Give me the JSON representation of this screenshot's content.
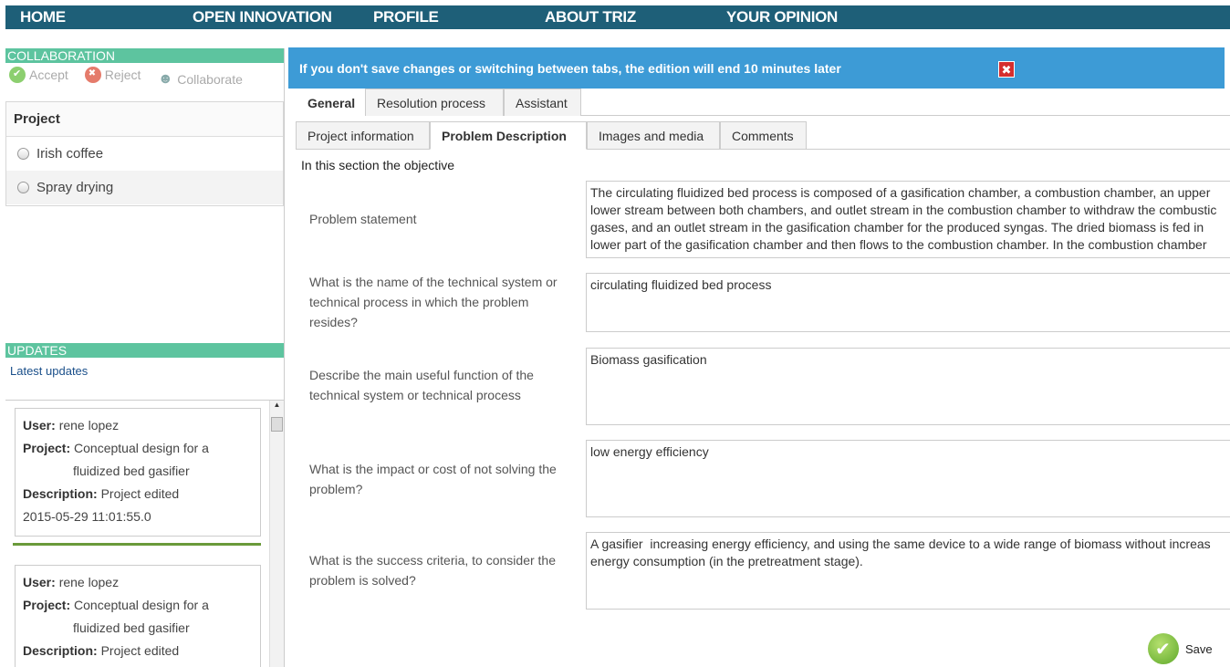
{
  "nav": [
    "HOME",
    "OPEN INNOVATION",
    "PROFILE",
    "ABOUT TRIZ",
    "YOUR OPINION"
  ],
  "collaboration": {
    "title": "COLLABORATION",
    "actions": [
      "Accept",
      "Reject",
      "Collaborate"
    ]
  },
  "project": {
    "title": "Project",
    "items": [
      "Irish coffee",
      "Spray drying"
    ]
  },
  "updates": {
    "title": "UPDATES",
    "latest_label": "Latest updates",
    "field_labels": {
      "user": "User:",
      "project": "Project:",
      "description": "Description:"
    },
    "entries": [
      {
        "user": "rene lopez",
        "project_line1": "Conceptual design for a",
        "project_line2": "fluidized bed gasifier",
        "description": "Project edited",
        "timestamp": "2015-05-29 11:01:55.0"
      },
      {
        "user": "rene lopez",
        "project_line1": "Conceptual design for a",
        "project_line2": "fluidized bed gasifier",
        "description": "Project edited"
      }
    ]
  },
  "banner": {
    "message": "If you don't save changes or switching between tabs, the edition will end 10 minutes later",
    "close_glyph": "✖"
  },
  "tabs_primary": [
    "General",
    "Resolution process",
    "Assistant"
  ],
  "tabs_secondary": [
    "Project information",
    "Problem Description",
    "Images and media",
    "Comments"
  ],
  "intro": "In this section the objective",
  "questions": [
    {
      "label": "Problem statement",
      "value": "The circulating fluidized bed process is composed of a gasification chamber, a combustion chamber, an upper\nlower stream between both chambers, and outlet stream in the combustion chamber to withdraw the combustic\ngases, and an outlet stream in the gasification chamber for the produced syngas. The dried biomass is fed in\nlower part of the gasification chamber and then flows to the combustion chamber. In the combustion chamber"
    },
    {
      "label": "What is the name of the technical system or technical process in which the problem resides?",
      "value": "circulating fluidized bed process"
    },
    {
      "label": "Describe the main useful function of the technical system or technical process",
      "value": "Biomass gasification"
    },
    {
      "label": "What is the impact or cost of not solving the problem?",
      "value": "low energy efficiency"
    },
    {
      "label": "What is the success criteria, to consider the problem is solved?",
      "value": "A gasifier  increasing energy efficiency, and using the same device to a wide range of biomass without increas\nenergy consumption (in the pretreatment stage)."
    }
  ],
  "save_label": "Save",
  "colors": {
    "nav_bg": "#1e5f78",
    "section_head": "#5dc49f",
    "banner": "#3d9bd6",
    "close": "#d52e2e"
  }
}
